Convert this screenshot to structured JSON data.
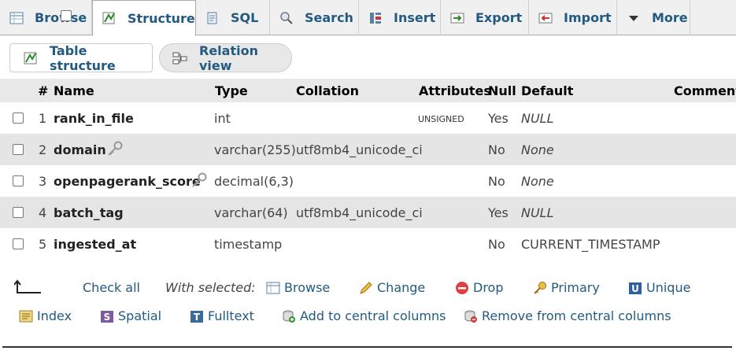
{
  "tabs": [
    {
      "label": "Browse",
      "icon": "browse-icon"
    },
    {
      "label": "Structure",
      "icon": "structure-icon"
    },
    {
      "label": "SQL",
      "icon": "sql-icon"
    },
    {
      "label": "Search",
      "icon": "search-icon"
    },
    {
      "label": "Insert",
      "icon": "insert-icon"
    },
    {
      "label": "Export",
      "icon": "export-icon"
    },
    {
      "label": "Import",
      "icon": "import-icon"
    },
    {
      "label": "More",
      "icon": "chevron-down-icon"
    }
  ],
  "subtabs": {
    "table_structure": "Table structure",
    "relation_view": "Relation view"
  },
  "columns": {
    "num": "#",
    "name": "Name",
    "type": "Type",
    "collation": "Collation",
    "attributes": "Attributes",
    "null": "Null",
    "default": "Default",
    "comments": "Comments"
  },
  "rows": [
    {
      "num": "1",
      "name": "rank_in_file",
      "type": "int",
      "collation": "",
      "attributes": "UNSIGNED",
      "null": "Yes",
      "default": "NULL"
    },
    {
      "num": "2",
      "name": "domain",
      "type": "varchar(255)",
      "collation": "utf8mb4_unicode_ci",
      "attributes": "",
      "null": "No",
      "default": "None"
    },
    {
      "num": "3",
      "name": "openpagerank_score",
      "type": "decimal(6,3)",
      "collation": "",
      "attributes": "",
      "null": "No",
      "default": "None"
    },
    {
      "num": "4",
      "name": "batch_tag",
      "type": "varchar(64)",
      "collation": "utf8mb4_unicode_ci",
      "attributes": "",
      "null": "Yes",
      "default": "NULL"
    },
    {
      "num": "5",
      "name": "ingested_at",
      "type": "timestamp",
      "collation": "",
      "attributes": "",
      "null": "No",
      "default": "CURRENT_TIMESTAMP"
    }
  ],
  "bulk": {
    "check_all": "Check all",
    "with_selected": "With selected:",
    "browse": "Browse",
    "change": "Change",
    "drop": "Drop",
    "primary": "Primary",
    "unique": "Unique",
    "index": "Index",
    "spatial": "Spatial",
    "fulltext": "Fulltext",
    "add_central": "Add to central columns",
    "remove_central": "Remove from central columns"
  }
}
